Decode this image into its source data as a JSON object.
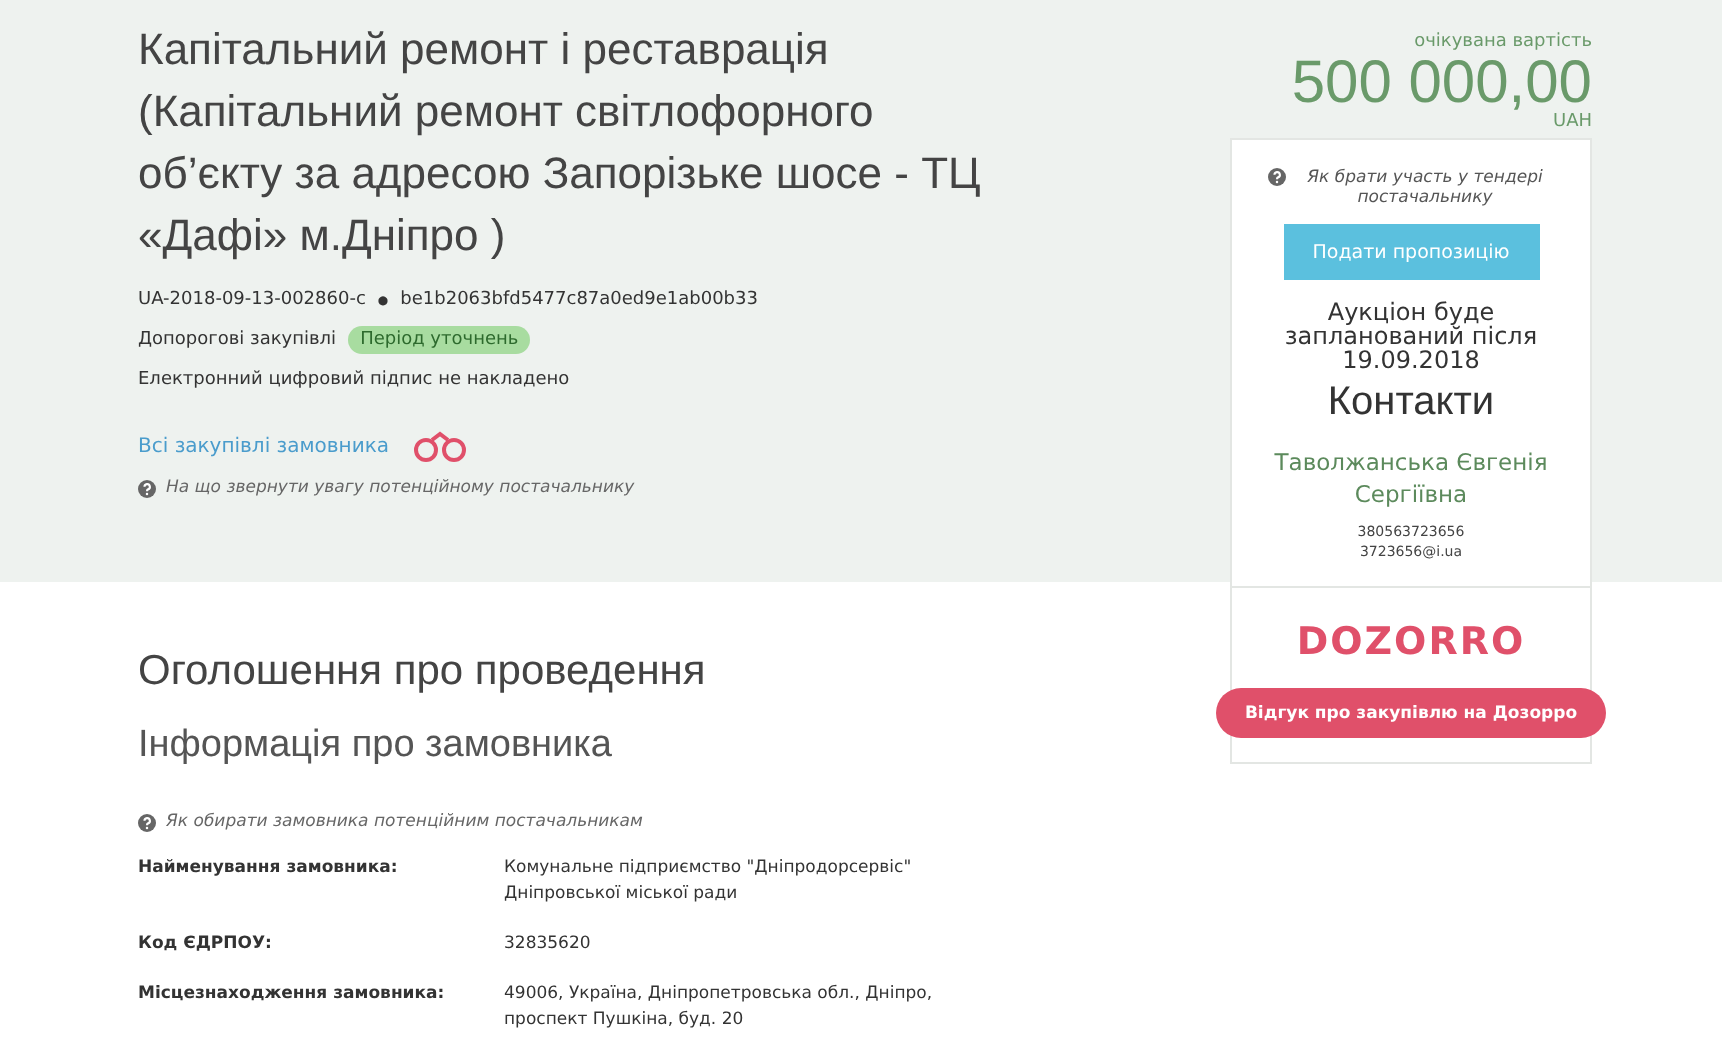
{
  "tender": {
    "title": "Капітальний ремонт і реставрація (Капітальний ремонт світлофорного об’єкту за адресою Запорізьке шосе - ТЦ «Дафі» м.Дніпро )",
    "id": "UA-2018-09-13-002860-c",
    "separator": "●",
    "hash": "be1b2063bfd5477c87a0ed9e1ab00b33",
    "procedure": "Допорогові закупівлі",
    "status": "Період уточнень",
    "signature": "Електронний цифровий підпис не накладено",
    "all_link": "Всі закупівлі замовника",
    "attention_link": "На що звернути увагу потенційному постачальнику"
  },
  "sidebar": {
    "value_label": "очікувана вартість",
    "amount": "500 000,00",
    "currency": "UAH",
    "howto_link": "Як брати участь у тендері постачальнику",
    "submit_button": "Подати пропозицію",
    "auction_note": "Аукціон буде запланований після 19.09.2018",
    "contacts_heading": "Контакти",
    "contact_name": "Таволжанська Євгенія Сергіївна",
    "contact_phone": "380563723656",
    "contact_email": "3723656@i.ua",
    "logo": "DOZORRO",
    "review_button": "Відгук про закупівлю на Дозорро"
  },
  "notice": {
    "heading": "Оголошення про проведення",
    "subheading": "Інформація про замовника",
    "help_link": "Як обирати замовника потенційним постачальникам",
    "rows": [
      {
        "label": "Найменування замовника:",
        "value": "Комунальне підприємство \"Дніпродорсервіс\" Дніпровської міської ради"
      },
      {
        "label": "Код ЄДРПОУ:",
        "value": "32835620"
      },
      {
        "label": "Місцезнаходження замовника:",
        "value": "49006, Україна, Дніпропетровська обл., Дніпро, проспект Пушкіна, буд. 20"
      }
    ]
  }
}
